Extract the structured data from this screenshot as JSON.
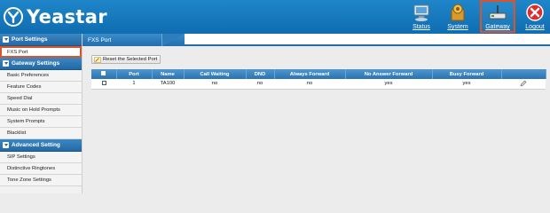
{
  "brand": {
    "name": "Yeastar"
  },
  "top_nav": [
    {
      "label": "Status",
      "icon": "monitor-icon"
    },
    {
      "label": "System",
      "icon": "gear-box-icon"
    },
    {
      "label": "Gateway",
      "icon": "gateway-device-icon"
    },
    {
      "label": "Logout",
      "icon": "close-circle-icon"
    }
  ],
  "sidebar": {
    "sections": [
      {
        "title": "Port Settings",
        "items": [
          "FXS Port"
        ]
      },
      {
        "title": "Gateway Settings",
        "items": [
          "Basic Preferences",
          "Feature Codes",
          "Speed Dial",
          "Music on Hold Prompts",
          "System Prompts",
          "Blacklist"
        ]
      },
      {
        "title": "Advanced Setting",
        "items": [
          "SIP Settings",
          "Distinctive Ringtones",
          "Tone Zone Settings"
        ]
      }
    ],
    "selected": "FXS Port"
  },
  "main": {
    "tab_label": "FXS Port",
    "reset_button": "Reset the Selected Port",
    "table": {
      "headers": [
        "",
        "Port",
        "Name",
        "Call Waiting",
        "DND",
        "Always Forward",
        "No Answer Forward",
        "Busy Forward",
        ""
      ],
      "rows": [
        {
          "port": "1",
          "name": "TA100",
          "call_waiting": "no",
          "dnd": "no",
          "always_forward": "no",
          "no_answer_forward": "yes",
          "busy_forward": "yes"
        }
      ]
    }
  },
  "colors": {
    "header_blue": "#1777bd",
    "highlight": "#d9542c"
  }
}
